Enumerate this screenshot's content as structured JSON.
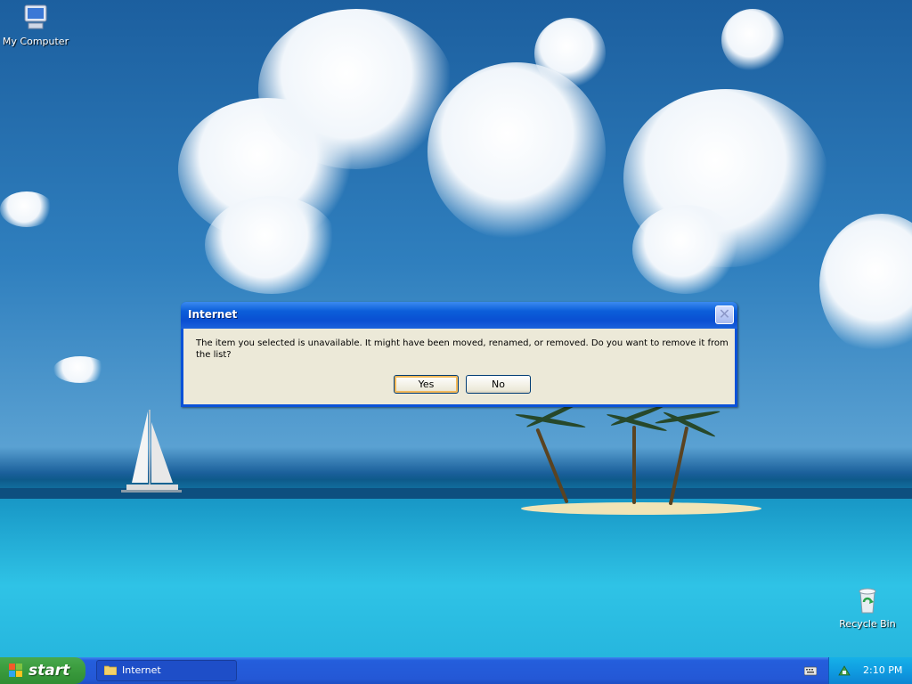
{
  "desktop": {
    "icons": [
      {
        "label": "My Computer"
      },
      {
        "label": "Recycle Bin"
      }
    ]
  },
  "dialog": {
    "title": "Internet",
    "message": "The item you selected is unavailable.  It might have been moved, renamed, or removed.  Do you want to remove it from the list?",
    "yes_label": "Yes",
    "no_label": "No"
  },
  "taskbar": {
    "start_label": "start",
    "task_label": "Internet",
    "clock": "2:10 PM"
  },
  "colors": {
    "titlebar": "#0a52d8",
    "dialog_face": "#ece9d8",
    "start_green": "#3c9d3f",
    "taskbar_blue": "#245edc",
    "tray_blue": "#0f98df"
  }
}
